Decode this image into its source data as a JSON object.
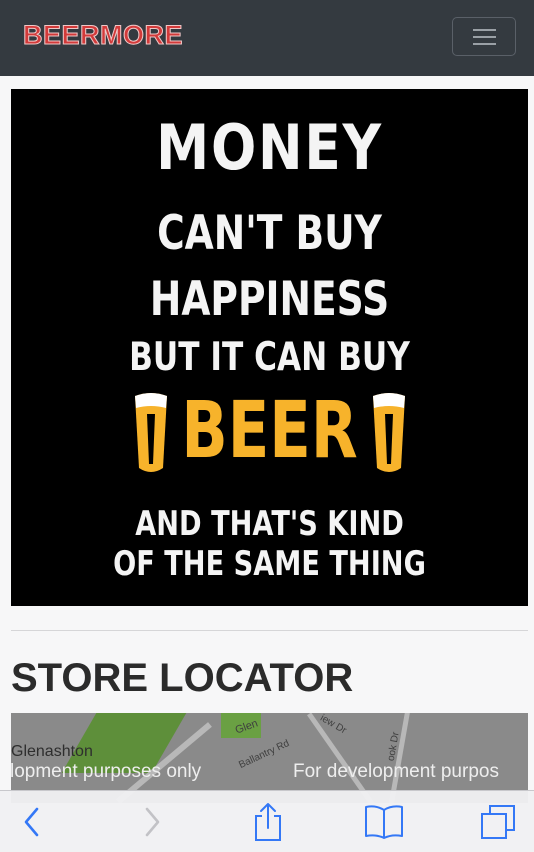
{
  "navbar": {
    "brand": "BEERMORE",
    "menu_icon": "hamburger-menu-icon"
  },
  "poster": {
    "line1": "MONEY",
    "line2": "CAN'T BUY",
    "line3": "HAPPINESS",
    "line4": "BUT IT CAN BUY",
    "beer": "BEER",
    "line5": "AND THAT'S KIND",
    "line6": "OF THE SAME THING",
    "colors": {
      "text": "#f4f4f4",
      "accent": "#f7b32b",
      "background": "#000000"
    }
  },
  "store_locator": {
    "title": "STORE LOCATOR",
    "map": {
      "place_label": "Glenashton",
      "street_1": "Glen",
      "street_2": "Ballantry Rd",
      "street_3": "iew Dr",
      "street_4": "ook Dr",
      "watermark_left": "lopment purposes only",
      "watermark_right": "For development purpos"
    }
  },
  "browser_toolbar": {
    "back_icon": "chevron-left-icon",
    "forward_icon": "chevron-right-icon",
    "share_icon": "share-icon",
    "bookmarks_icon": "book-icon",
    "tabs_icon": "tabs-icon",
    "accent": "#3478f6"
  }
}
